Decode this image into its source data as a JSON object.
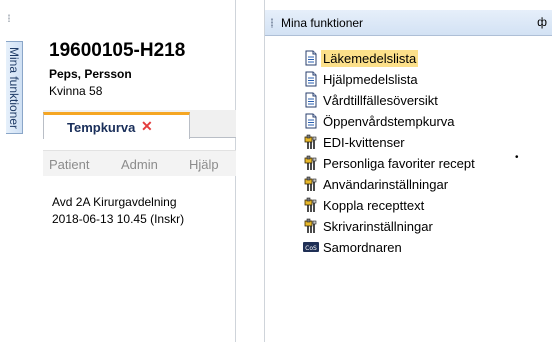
{
  "left_panel": {
    "side_tab_label": "Mina funktioner",
    "patient": {
      "id": "19600105-H218",
      "name": "Peps, Persson",
      "gender_age": "Kvinna 58"
    },
    "tab": {
      "label": "Tempkurva",
      "close_glyph": "✕"
    },
    "menu": [
      {
        "label": "Patient"
      },
      {
        "label": "Admin"
      },
      {
        "label": "Hjälp"
      }
    ],
    "info_lines": [
      "Avd 2A Kirurgavdelning",
      "2018-06-13 10.45 (Inskr)"
    ]
  },
  "right_panel": {
    "title": "Mina funktioner",
    "pin_glyph": "ф",
    "marker_glyph": "•",
    "items": [
      {
        "label": "Läkemedelslista",
        "icon": "document-icon",
        "selected": true
      },
      {
        "label": "Hjälpmedelslista",
        "icon": "document-icon",
        "selected": false
      },
      {
        "label": "Vårdtillfällesöversikt",
        "icon": "document-icon",
        "selected": false
      },
      {
        "label": "Öppenvårdstempkurva",
        "icon": "document-icon",
        "selected": false
      },
      {
        "label": "EDI-kvittenser",
        "icon": "tool-icon",
        "selected": false
      },
      {
        "label": "Personliga favoriter recept",
        "icon": "tool-icon",
        "selected": false
      },
      {
        "label": "Användarinställningar",
        "icon": "tool-icon",
        "selected": false
      },
      {
        "label": "Koppla recepttext",
        "icon": "tool-icon",
        "selected": false
      },
      {
        "label": "Skrivarinställningar",
        "icon": "tool-icon",
        "selected": false
      },
      {
        "label": "Samordnaren",
        "icon": "samordnaren-icon",
        "selected": false
      }
    ]
  },
  "colors": {
    "selection": "#fce08a",
    "tab_accent": "#f5a623",
    "tab_close": "#e43d3d",
    "header_gradient_top": "#e6effa",
    "header_gradient_bottom": "#d3e2f4"
  }
}
